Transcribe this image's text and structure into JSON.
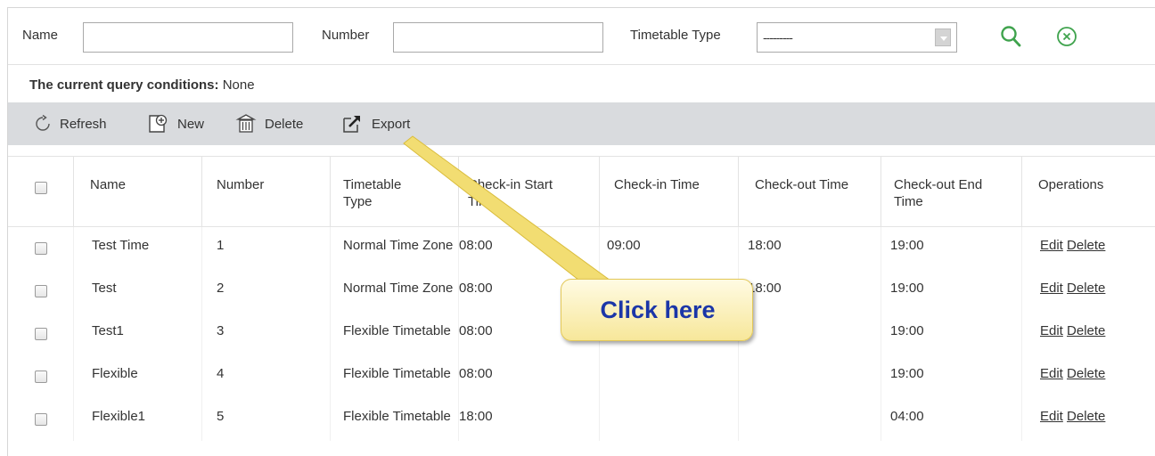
{
  "search": {
    "name_label": "Name",
    "name_value": "",
    "number_label": "Number",
    "number_value": "",
    "type_label": "Timetable Type",
    "type_value": "---------"
  },
  "query": {
    "label": "The current query conditions:",
    "value": "None"
  },
  "toolbar": {
    "refresh": "Refresh",
    "new": "New",
    "delete": "Delete",
    "export": "Export"
  },
  "table": {
    "headers": {
      "name": "Name",
      "number": "Number",
      "type_l1": "Timetable",
      "type_l2": "Type",
      "checkin_start_l1": "Check-in Start",
      "checkin_start_l2": "Time",
      "checkin": "Check-in Time",
      "checkout": "Check-out Time",
      "checkout_end_l1": "Check-out End",
      "checkout_end_l2": "Time",
      "operations": "Operations"
    },
    "rows": [
      {
        "name": "Test Time",
        "number": "1",
        "type": "Normal Time Zone",
        "checkin_start": "08:00",
        "checkin": "09:00",
        "checkout": "18:00",
        "checkout_end": "19:00",
        "edit": "Edit",
        "delete": "Delete"
      },
      {
        "name": "Test",
        "number": "2",
        "type": "Normal Time Zone",
        "checkin_start": "08:00",
        "checkin": "",
        "checkout": "18:00",
        "checkout_end": "19:00",
        "edit": "Edit",
        "delete": "Delete"
      },
      {
        "name": "Test1",
        "number": "3",
        "type": "Flexible Timetable",
        "checkin_start": "08:00",
        "checkin": "",
        "checkout": "",
        "checkout_end": "19:00",
        "edit": "Edit",
        "delete": "Delete"
      },
      {
        "name": "Flexible",
        "number": "4",
        "type": "Flexible Timetable",
        "checkin_start": "08:00",
        "checkin": "",
        "checkout": "",
        "checkout_end": "19:00",
        "edit": "Edit",
        "delete": "Delete"
      },
      {
        "name": "Flexible1",
        "number": "5",
        "type": "Flexible Timetable",
        "checkin_start": "18:00",
        "checkin": "",
        "checkout": "",
        "checkout_end": "04:00",
        "edit": "Edit",
        "delete": "Delete"
      }
    ]
  },
  "callout": {
    "text": "Click here"
  },
  "colors": {
    "toolbar_bg": "#d9dbde",
    "icon_green": "#3fa34d",
    "callout_text": "#1b36a8",
    "callout_fill": "#f7e79a"
  }
}
